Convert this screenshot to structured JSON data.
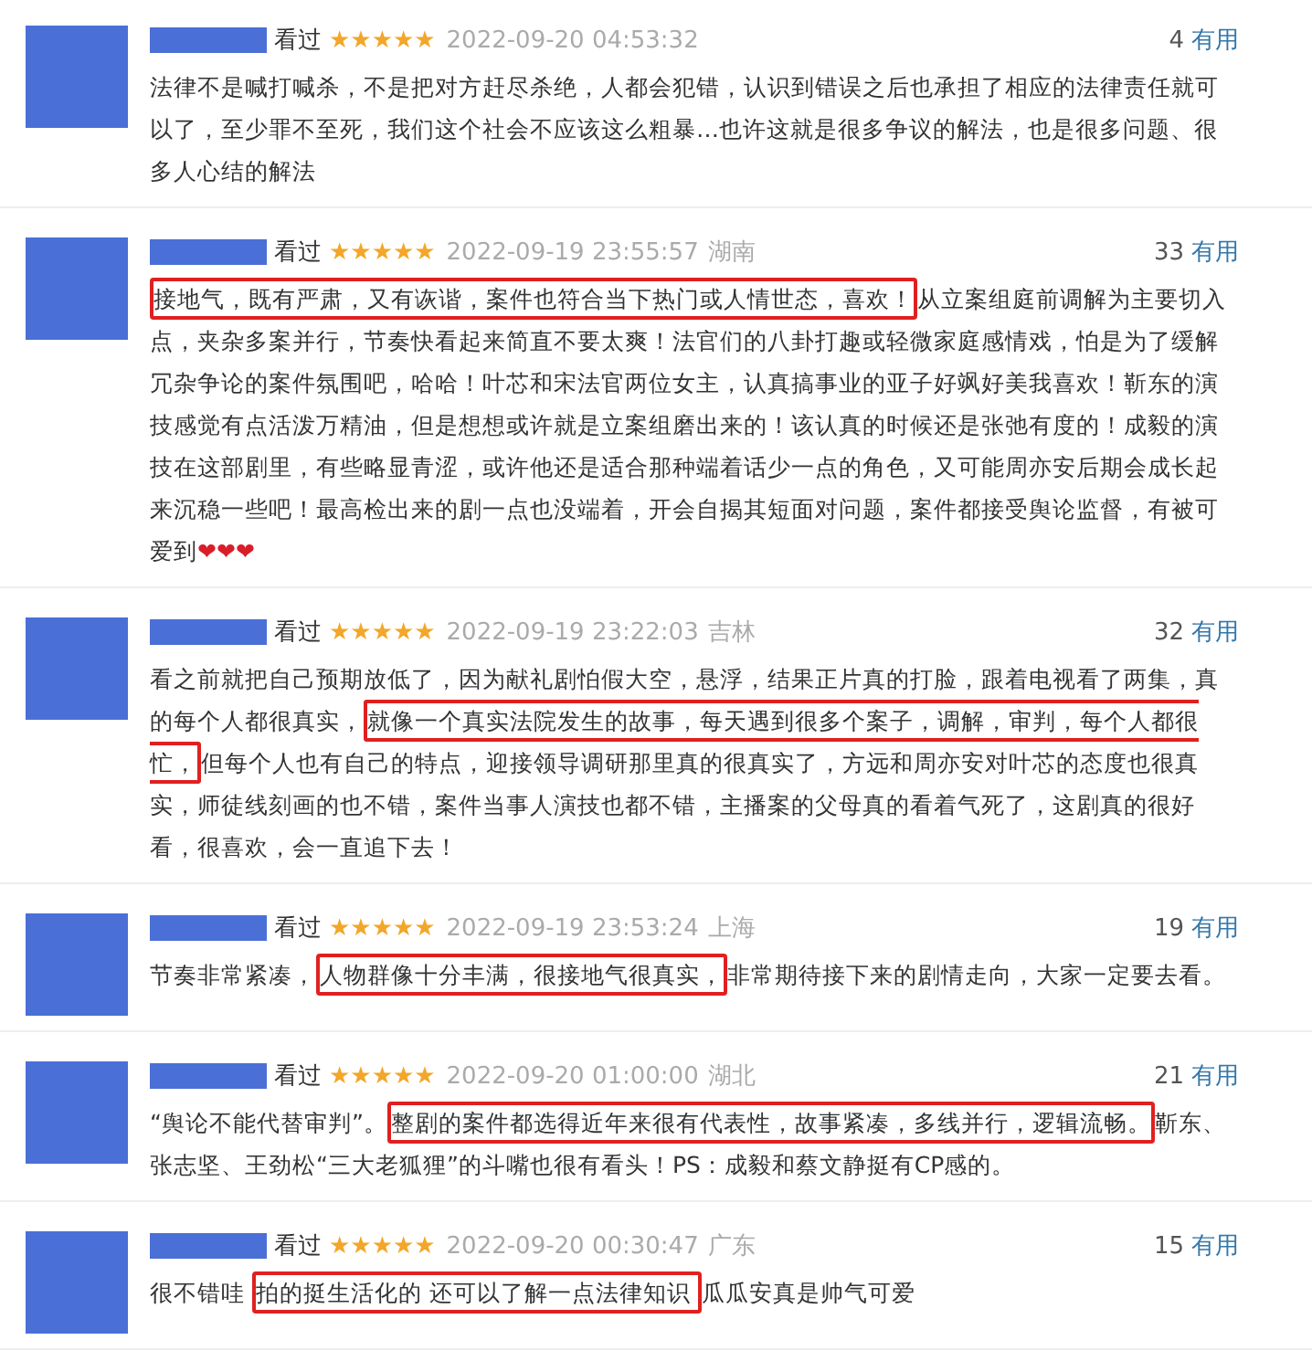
{
  "reviews": [
    {
      "status": "看过",
      "stars": 5,
      "date": "2022-09-20 04:53:32",
      "count": "4",
      "useful": "有用",
      "body": {
        "before": "法律不是喊打喊杀，不是把对方赶尽杀绝，人都会犯错，认识到错误之后也承担了相应的法律责任就可以了，至少罪不至死，我们这个社会不应该这么粗暴…也许这就是很多争议的解法，也是很多问题、很多人心结的解法"
      }
    },
    {
      "status": "看过",
      "stars": 5,
      "date": "2022-09-19 23:55:57",
      "location": "湖南",
      "count": "33",
      "useful": "有用",
      "body": {
        "highlight": "接地气，既有严肃，又有诙谐，案件也符合当下热门或人情世态，喜欢！",
        "after": "从立案组庭前调解为主要切入点，夹杂多案并行，节奏快看起来简直不要太爽！法官们的八卦打趣或轻微家庭感情戏，怕是为了缓解冗杂争论的案件氛围吧，哈哈！叶芯和宋法官两位女主，认真搞事业的亚子好飒好美我喜欢！靳东的演技感觉有点活泼万精油，但是想想或许就是立案组磨出来的！该认真的时候还是张弛有度的！成毅的演技在这部剧里，有些略显青涩，或许他还是适合那种端着话少一点的角色，又可能周亦安后期会成长起来沉稳一些吧！最高检出来的剧一点也没端着，开会自揭其短面对问题，案件都接受舆论监督，有被可爱到❤❤❤"
      }
    },
    {
      "status": "看过",
      "stars": 5,
      "date": "2022-09-19 23:22:03",
      "location": "吉林",
      "count": "32",
      "useful": "有用",
      "body": {
        "before": "看之前就把自己预期放低了，因为献礼剧怕假大空，悬浮，结果正片真的打脸，跟着电视看了两集，真的每个人都很真实，",
        "highlight": "就像一个真实法院发生的故事，每天遇到很多个案子，调解，审判，每个人都很忙，",
        "after": "但每个人也有自己的特点，迎接领导调研那里真的很真实了，方远和周亦安对叶芯的态度也很真实，师徒线刻画的也不错，案件当事人演技也都不错，主播案的父母真的看着气死了，这剧真的很好看，很喜欢，会一直追下去！"
      }
    },
    {
      "status": "看过",
      "stars": 5,
      "date": "2022-09-19 23:53:24",
      "location": "上海",
      "count": "19",
      "useful": "有用",
      "body": {
        "before": "节奏非常紧凑，",
        "highlight": "人物群像十分丰满，很接地气很真实，",
        "after": "非常期待接下来的剧情走向，大家一定要去看。"
      }
    },
    {
      "status": "看过",
      "stars": 5,
      "date": "2022-09-20 01:00:00",
      "location": "湖北",
      "count": "21",
      "useful": "有用",
      "body": {
        "before": "“舆论不能代替审判”。",
        "highlight": "整剧的案件都选得近年来很有代表性，故事紧凑，多线并行，逻辑流畅。",
        "after": "靳东、张志坚、王劲松“三大老狐狸”的斗嘴也很有看头！PS：成毅和蔡文静挺有CP感的。"
      }
    },
    {
      "status": "看过",
      "stars": 5,
      "date": "2022-09-20 00:30:47",
      "location": "广东",
      "count": "15",
      "useful": "有用",
      "body": {
        "before": "很不错哇 ",
        "highlight": "拍的挺生活化的 还可以了解一点法律知识 ",
        "after": "瓜瓜安真是帅气可爱"
      }
    }
  ]
}
